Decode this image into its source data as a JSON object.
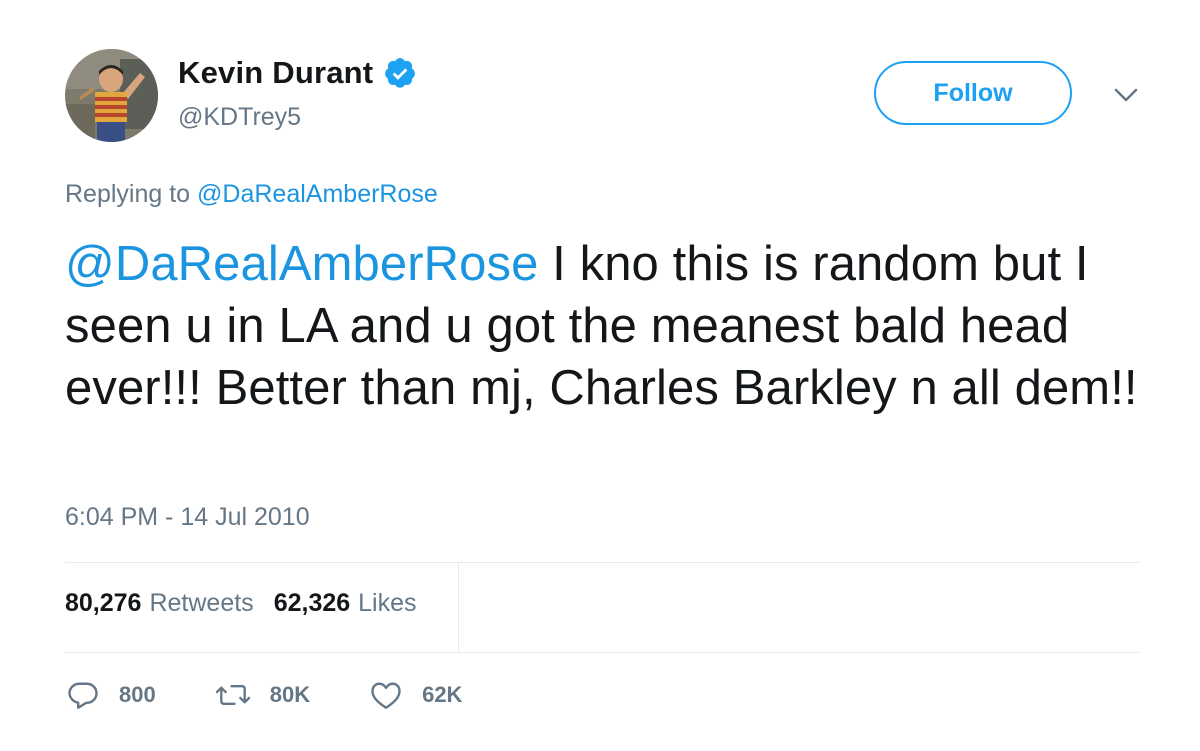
{
  "author": {
    "display_name": "Kevin Durant",
    "handle": "@KDTrey5",
    "verified": true
  },
  "follow_label": "Follow",
  "reply_context": {
    "prefix": "Replying to",
    "mention": "@DaRealAmberRose"
  },
  "tweet": {
    "mention": "@DaRealAmberRose",
    "text": " I kno this is random but I seen u in LA and u got the meanest bald head ever!!! Better than mj, Charles Barkley n all dem!!",
    "timestamp": "6:04 PM - 14 Jul 2010"
  },
  "stats": {
    "retweets_count": "80,276",
    "retweets_label": "Retweets",
    "likes_count": "62,326",
    "likes_label": "Likes"
  },
  "actions": {
    "reply_count": "800",
    "retweet_count": "80K",
    "like_count": "62K"
  },
  "colors": {
    "accent": "#1da1f2",
    "mention": "#1b95e0",
    "secondary_text": "#657786",
    "primary_text": "#14171a",
    "divider": "#e6ecf0"
  },
  "icons": {
    "verified": "verified-badge-icon",
    "caret": "chevron-down-icon",
    "reply": "reply-bubble-icon",
    "retweet": "retweet-icon",
    "like": "heart-icon"
  }
}
